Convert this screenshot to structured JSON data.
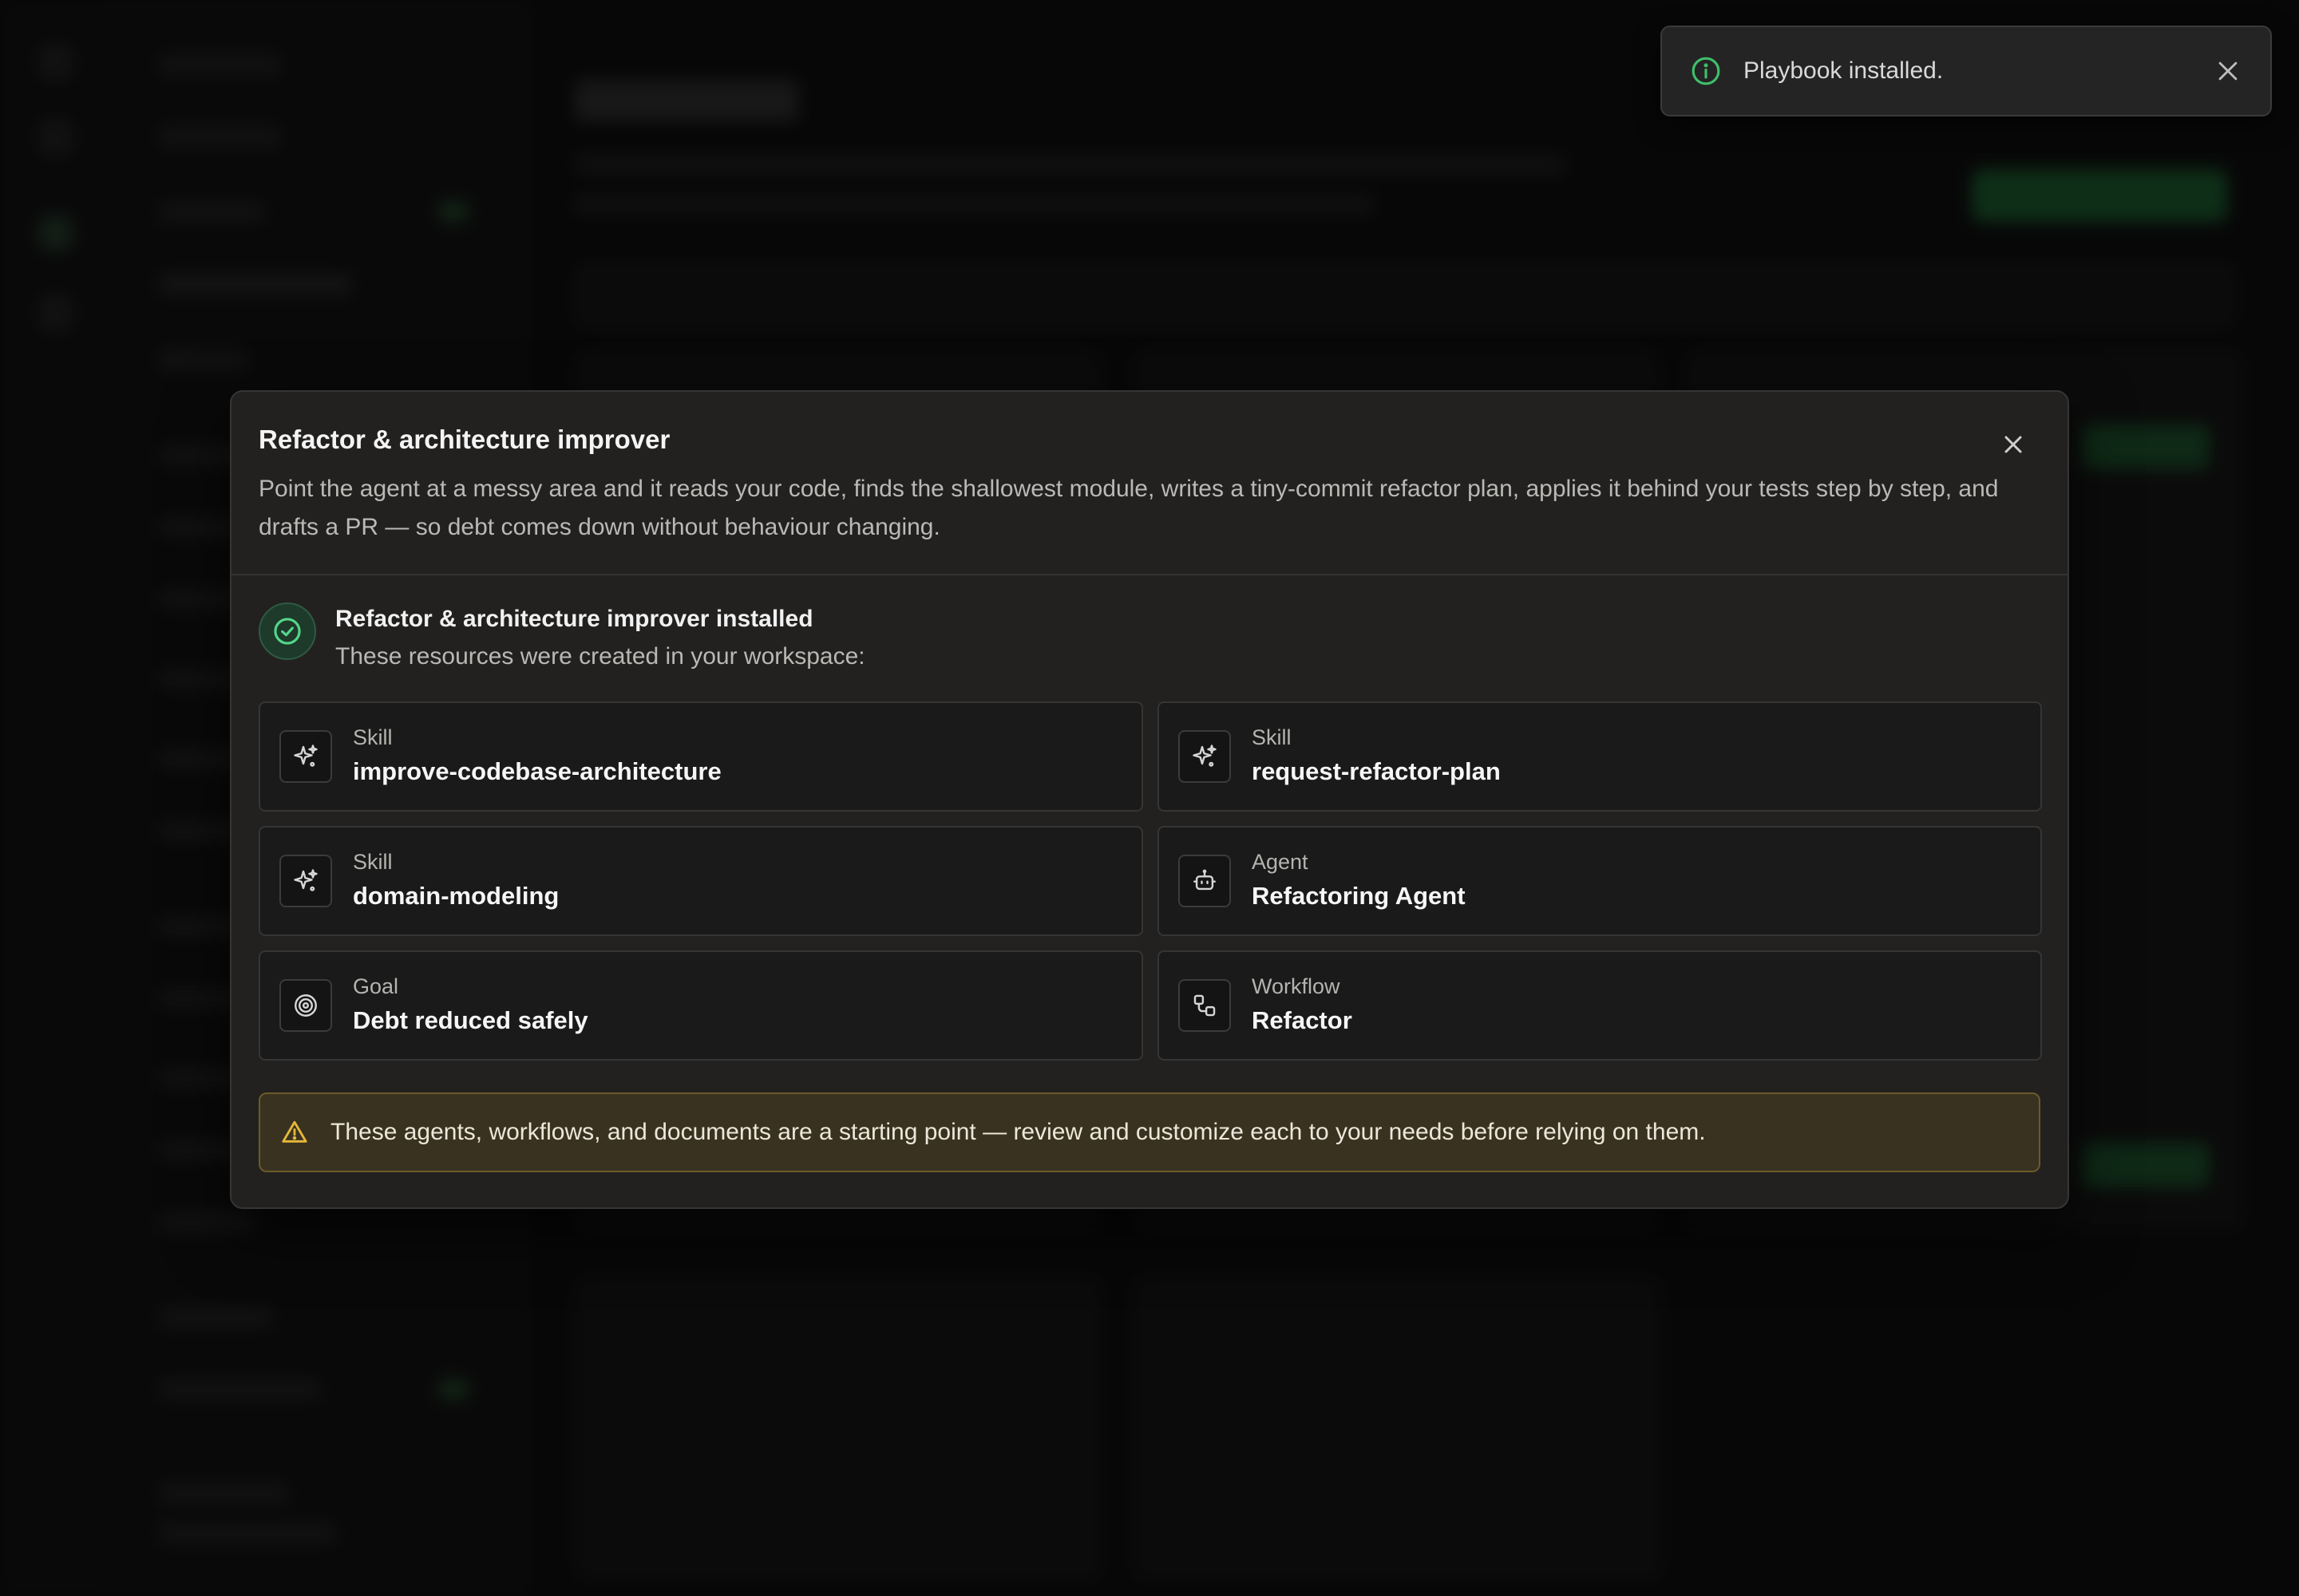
{
  "toast": {
    "message": "Playbook installed.",
    "icon": "info-icon",
    "accent": "#3fbf6a"
  },
  "modal": {
    "title": "Refactor & architecture improver",
    "description": "Point the agent at a messy area and it reads your code, finds the shallowest module, writes a tiny-commit refactor plan, applies it behind your tests step by step, and drafts a PR — so debt comes down without behaviour changing.",
    "installed_title": "Refactor & architecture improver installed",
    "installed_subtitle": "These resources were created in your workspace:",
    "resources": [
      {
        "kind": "Skill",
        "name": "improve-codebase-architecture",
        "icon": "sparkles-icon"
      },
      {
        "kind": "Skill",
        "name": "request-refactor-plan",
        "icon": "sparkles-icon"
      },
      {
        "kind": "Skill",
        "name": "domain-modeling",
        "icon": "sparkles-icon"
      },
      {
        "kind": "Agent",
        "name": "Refactoring Agent",
        "icon": "robot-icon"
      },
      {
        "kind": "Goal",
        "name": "Debt reduced safely",
        "icon": "target-icon"
      },
      {
        "kind": "Workflow",
        "name": "Refactor",
        "icon": "workflow-icon"
      }
    ],
    "warning": "These agents, workflows, and documents are a starting point — review and customize each to your needs before relying on them.",
    "success_color": "#55d68a",
    "warning_color": "#e6b93a"
  }
}
